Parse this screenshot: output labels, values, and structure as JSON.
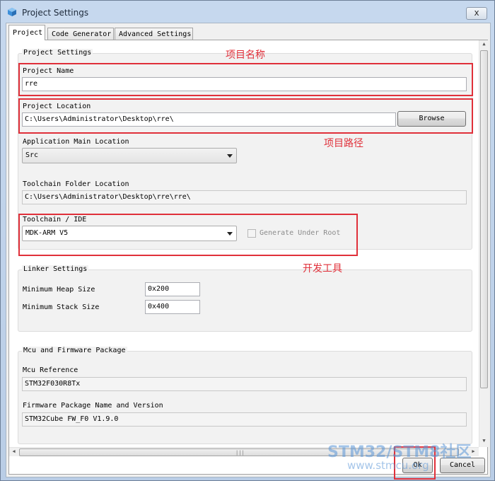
{
  "window": {
    "title": "Project Settings",
    "close_glyph": "x"
  },
  "tabs": [
    {
      "label": "Project",
      "active": true
    },
    {
      "label": "Code Generator",
      "active": false
    },
    {
      "label": "Advanced Settings",
      "active": false
    }
  ],
  "project_settings": {
    "group_title": "Project Settings",
    "name_label": "Project Name",
    "name_value": "rre",
    "location_label": "Project Location",
    "location_value": "C:\\Users\\Administrator\\Desktop\\rre\\",
    "browse_label": "Browse",
    "app_main_label": "Application Main Location",
    "app_main_value": "Src",
    "toolchain_folder_label": "Toolchain Folder Location",
    "toolchain_folder_value": "C:\\Users\\Administrator\\Desktop\\rre\\rre\\",
    "toolchain_label": "Toolchain / IDE",
    "toolchain_value": "MDK-ARM V5",
    "generate_under_root_label": "Generate Under Root",
    "generate_under_root_checked": false
  },
  "linker_settings": {
    "group_title": "Linker Settings",
    "heap_label": "Minimum Heap Size",
    "heap_value": "0x200",
    "stack_label": "Minimum Stack Size",
    "stack_value": "0x400"
  },
  "mcu_package": {
    "group_title": "Mcu and Firmware Package",
    "mcu_ref_label": "Mcu Reference",
    "mcu_ref_value": "STM32F030R8Tx",
    "fw_label": "Firmware Package Name and Version",
    "fw_value": "STM32Cube FW_F0 V1.9.0"
  },
  "footer": {
    "ok_label": "Ok",
    "cancel_label": "Cancel"
  },
  "annotations": {
    "project_name": "项目名称",
    "project_path": "项目路径",
    "dev_tool": "开发工具"
  },
  "watermark": {
    "line1": "STM32/STM8社区",
    "line2": "www.stmcu.org"
  },
  "colors": {
    "annotation_red": "#e0303a",
    "watermark_blue": "#5a96d7"
  }
}
